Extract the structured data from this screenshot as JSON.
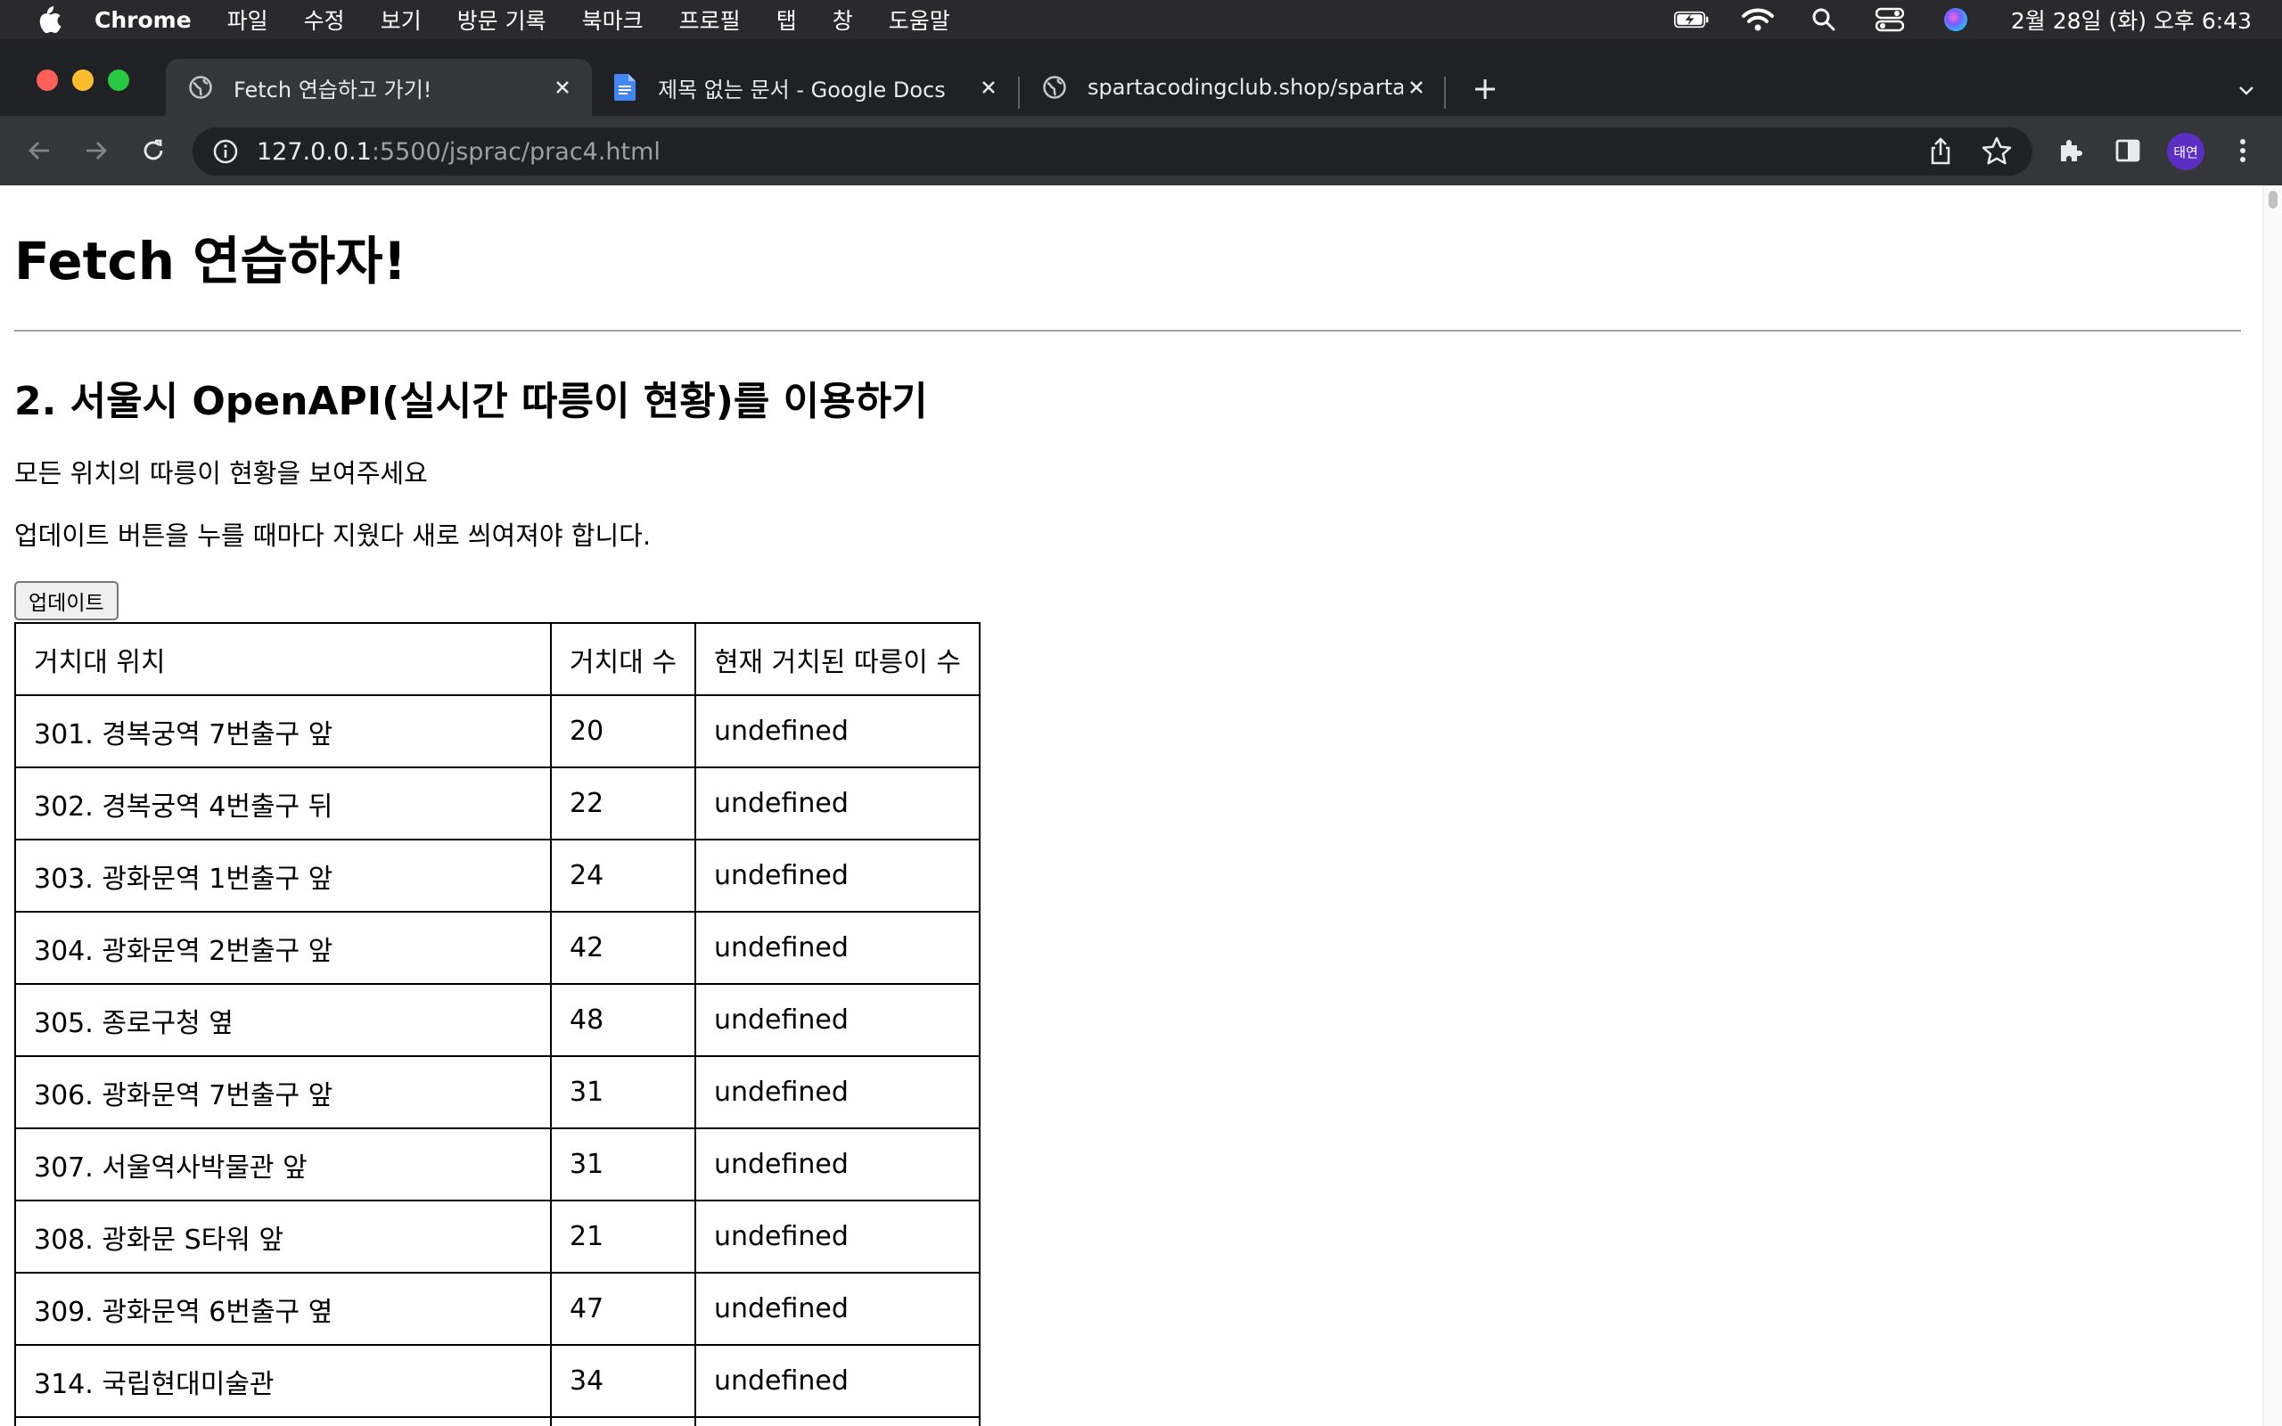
{
  "menubar": {
    "app_name": "Chrome",
    "menus": [
      "파일",
      "수정",
      "보기",
      "방문 기록",
      "북마크",
      "프로필",
      "탭",
      "창",
      "도움말"
    ],
    "clock": "2월 28일 (화) 오후 6:43"
  },
  "tabs": [
    {
      "title": "Fetch 연습하고 가기!",
      "favicon": "globe-icon",
      "active": true
    },
    {
      "title": "제목 없는 문서 - Google Docs",
      "favicon": "docs-icon",
      "active": false
    },
    {
      "title": "spartacodingclub.shop/sparta_",
      "favicon": "globe-icon",
      "active": false
    }
  ],
  "toolbar": {
    "url_host": "127.0.0.1",
    "url_rest": ":5500/jsprac/prac4.html",
    "profile_initials": "태연"
  },
  "page": {
    "title": "Fetch 연습하자!",
    "section_title": "2. 서울시 OpenAPI(실시간 따릉이 현황)를 이용하기",
    "paragraph_1": "모든 위치의 따릉이 현황을 보여주세요",
    "paragraph_2": "업데이트 버튼을 누를 때마다 지웠다 새로 씌여져야 합니다.",
    "update_button": "업데이트"
  },
  "table": {
    "headers": [
      "거치대 위치",
      "거치대 수",
      "현재 거치된 따릉이 수"
    ],
    "rows": [
      [
        "301. 경복궁역 7번출구 앞",
        "20",
        "undefined"
      ],
      [
        "302. 경복궁역 4번출구 뒤",
        "22",
        "undefined"
      ],
      [
        "303. 광화문역 1번출구 앞",
        "24",
        "undefined"
      ],
      [
        "304. 광화문역 2번출구 앞",
        "42",
        "undefined"
      ],
      [
        "305. 종로구청 옆",
        "48",
        "undefined"
      ],
      [
        "306. 광화문역 7번출구 앞",
        "31",
        "undefined"
      ],
      [
        "307. 서울역사박물관 앞",
        "31",
        "undefined"
      ],
      [
        "308. 광화문 S타워 앞",
        "21",
        "undefined"
      ],
      [
        "309. 광화문역 6번출구 옆",
        "47",
        "undefined"
      ],
      [
        "314. 국립현대미술관",
        "34",
        "undefined"
      ],
      [
        "",
        "",
        ""
      ]
    ]
  },
  "colors": {
    "menubar_bg": "#2a2a2c",
    "tabstrip_bg": "#202124",
    "active_tab_bg": "#35363a",
    "omnibox_bg": "#202124",
    "avatar_bg": "#5b2fc4"
  }
}
